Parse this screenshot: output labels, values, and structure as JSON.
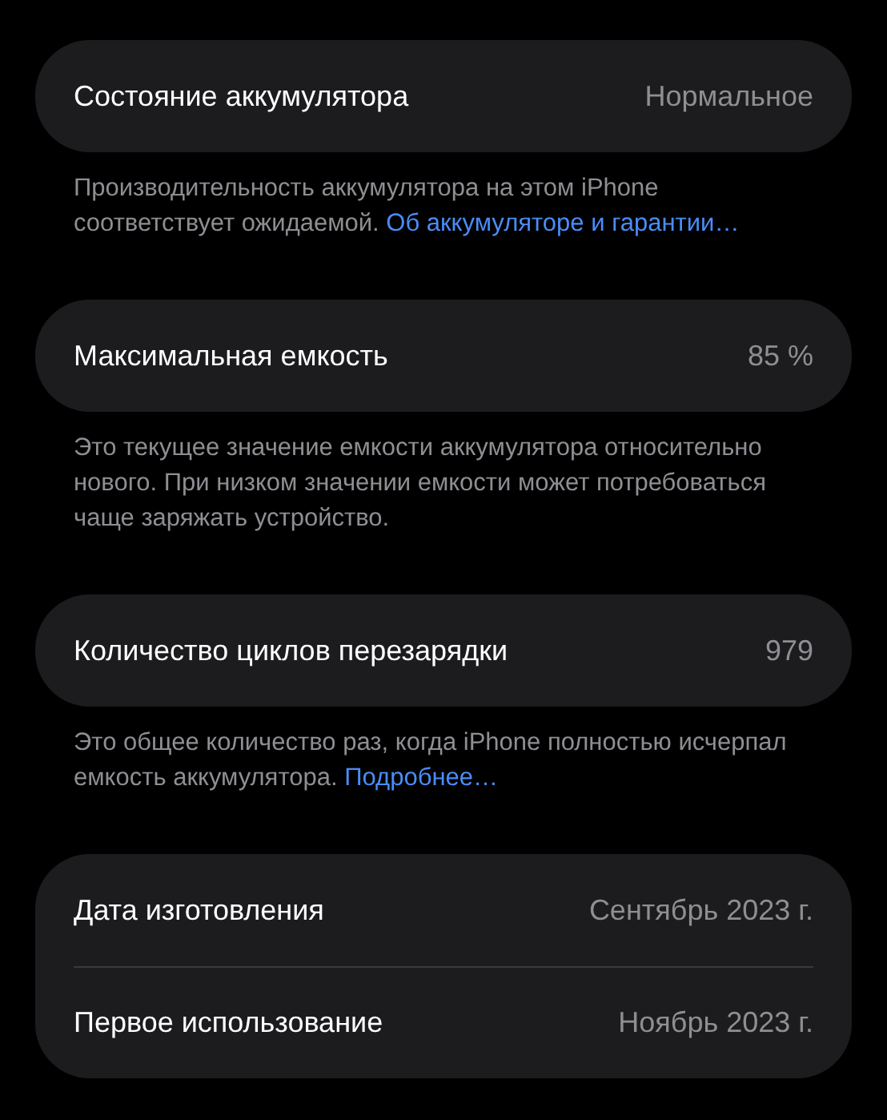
{
  "sections": [
    {
      "rows": [
        {
          "label": "Состояние аккумулятора",
          "value": "Нормальное"
        }
      ],
      "footer": {
        "text": "Производительность аккумулятора на этом iPhone соответствует ожидаемой.",
        "link": "Об аккумуляторе и гарантии…"
      }
    },
    {
      "rows": [
        {
          "label": "Максимальная емкость",
          "value": "85 %"
        }
      ],
      "footer": {
        "text": "Это текущее значение емкости аккумулятора относительно нового. При низком значении емкости может потребоваться чаще заряжать устройство."
      }
    },
    {
      "rows": [
        {
          "label": "Количество циклов перезарядки",
          "value": "979"
        }
      ],
      "footer": {
        "text": "Это общее количество раз, когда iPhone полностью исчерпал емкость аккумулятора.",
        "link": "Подробнее…"
      }
    },
    {
      "rows": [
        {
          "label": "Дата изготовления",
          "value": "Сентябрь 2023 г."
        },
        {
          "label": "Первое использование",
          "value": "Ноябрь 2023 г."
        }
      ]
    }
  ]
}
